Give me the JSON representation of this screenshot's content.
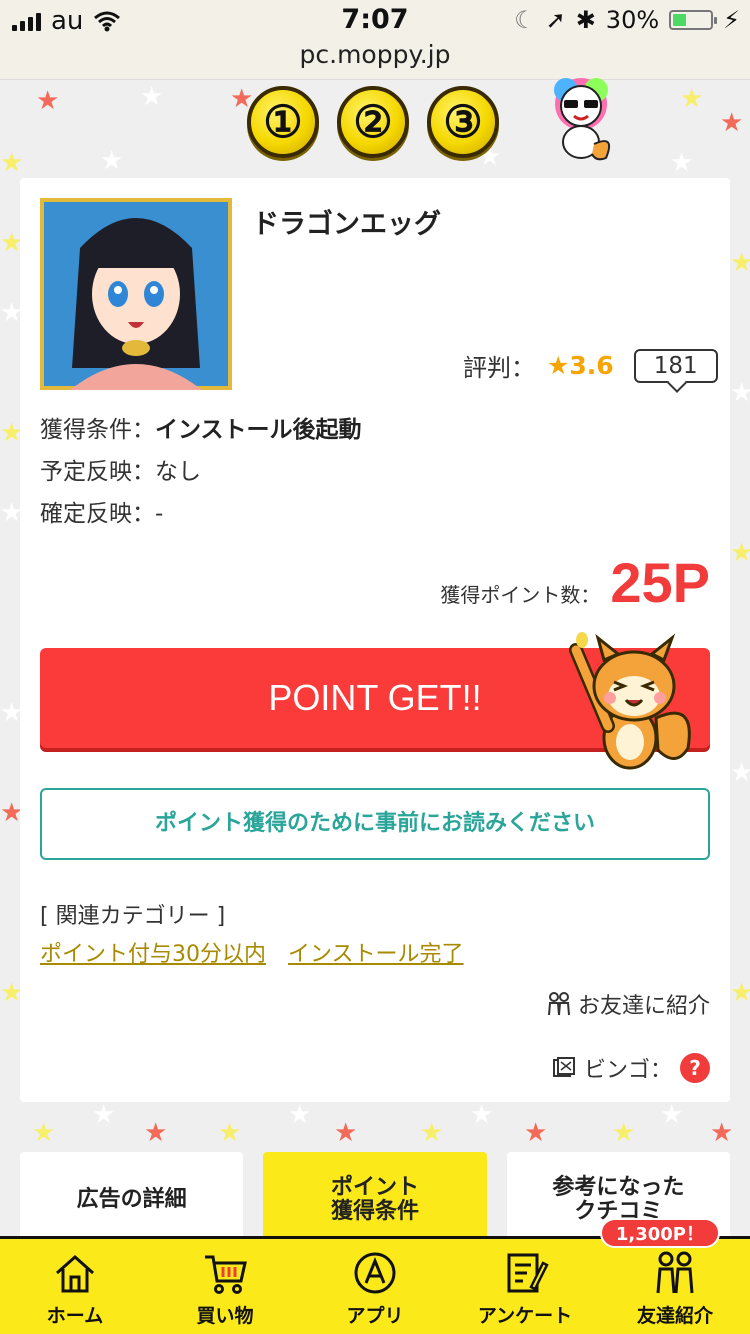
{
  "status_bar": {
    "carrier": "au",
    "time": "7:07",
    "battery": "30%",
    "url": "pc.moppy.jp"
  },
  "steps": [
    "①",
    "②",
    "③"
  ],
  "app": {
    "title": "ドラゴンエッグ",
    "rating_label": "評判：",
    "rating_value": "★3.6",
    "review_count": "181"
  },
  "conditions": [
    {
      "label": "獲得条件：",
      "value": "インストール後起動",
      "bold": true
    },
    {
      "label": "予定反映：",
      "value": "なし",
      "bold": false
    },
    {
      "label": "確定反映：",
      "value": "-",
      "bold": false
    }
  ],
  "points": {
    "label": "獲得ポイント数：",
    "value": "25P"
  },
  "buttons": {
    "point_get": "POINT GET!!",
    "read_first": "ポイント獲得のために事前にお読みください"
  },
  "categories": {
    "heading": "[ 関連カテゴリー ]",
    "links": [
      "ポイント付与30分以内",
      "インストール完了"
    ]
  },
  "friend_intro": "お友達に紹介",
  "bingo_label": "ビンゴ：",
  "bingo_help": "?",
  "tabs": [
    {
      "label": "広告の詳細",
      "active": false
    },
    {
      "label": "ポイント\n獲得条件",
      "active": true
    },
    {
      "label": "参考になった\nクチコミ",
      "active": false
    }
  ],
  "nav": {
    "badge": "1,300P！",
    "items": [
      {
        "label": "ホーム",
        "icon": "home-icon"
      },
      {
        "label": "買い物",
        "icon": "cart-icon"
      },
      {
        "label": "アプリ",
        "icon": "app-icon"
      },
      {
        "label": "アンケート",
        "icon": "survey-icon"
      },
      {
        "label": "友達紹介",
        "icon": "friends-icon"
      }
    ]
  },
  "colors": {
    "accent_red": "#fb3a3a",
    "accent_yellow": "#fbe91a",
    "teal": "#2aa59a",
    "link_gold": "#a88a00"
  }
}
